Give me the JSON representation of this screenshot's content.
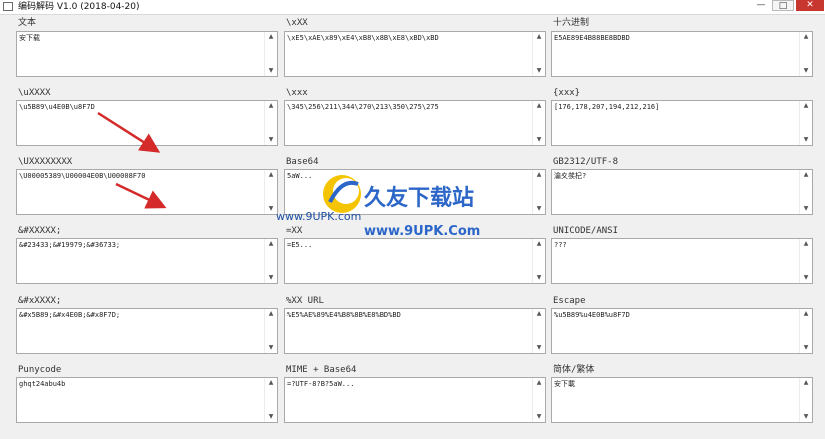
{
  "window": {
    "title": "编码解码 V1.0  (2018-04-20)",
    "min_label": "—",
    "max_label": "□",
    "close_label": "✕"
  },
  "fields": {
    "text": {
      "label": "文本",
      "value": "安下载"
    },
    "xXX": {
      "label": "\\xXX",
      "value": "\\xE5\\xAE\\x89\\xE4\\xB8\\x8B\\xE8\\xBD\\xBD"
    },
    "hex": {
      "label": "十六进制",
      "value": "E5AE89E4B88BE8BDBD"
    },
    "uXXXX": {
      "label": "\\uXXXX",
      "value": "\\u5B89\\u4E0B\\u8F7D"
    },
    "xxx": {
      "label": "\\xxx",
      "value": "\\345\\256\\211\\344\\270\\213\\350\\275\\275"
    },
    "xxx_braces": {
      "label": "{xxx}",
      "value": "[176,178,207,194,212,216]"
    },
    "UXXXXXXXX": {
      "label": "\\UXXXXXXXX",
      "value": "\\U00005389\\U00004E0B\\U00008F70"
    },
    "base64": {
      "label": "Base64",
      "value": "5aW..."
    },
    "gb2312": {
      "label": "GB2312/UTF-8",
      "value": "瀹夊彂杞?"
    },
    "ampXXXXX": {
      "label": "&#XXXXX;",
      "value": "&#23433;&#19979;&#36733;"
    },
    "eqXX": {
      "label": "=XX",
      "value": "=E5..."
    },
    "unicode_ansi": {
      "label": "UNICODE/ANSI",
      "value": "???"
    },
    "ampxXXXX": {
      "label": "&#xXXXX;",
      "value": "&#x5B89;&#x4E0B;&#x8F7D;"
    },
    "url": {
      "label": "%XX   URL",
      "value": "%E5%AE%89%E4%B8%8B%E8%BD%BD"
    },
    "escape": {
      "label": "Escape",
      "value": "%u5B89%u4E0B%u8F7D"
    },
    "punycode": {
      "label": "Punycode",
      "value": "ghqt24abu4b"
    },
    "mime": {
      "label": "MIME + Base64",
      "value": "=?UTF-8?B?5aW..."
    },
    "simp_trad": {
      "label": "简体/繁体",
      "value": "安下載"
    }
  },
  "watermark": {
    "main": "久友下载站",
    "url": "www.9UPK.Com",
    "www": "www.9UPK.com"
  },
  "colors": {
    "arrow_red": "#d42a2a",
    "watermark_blue": "#2b66c8",
    "close_red": "#c7372f"
  }
}
